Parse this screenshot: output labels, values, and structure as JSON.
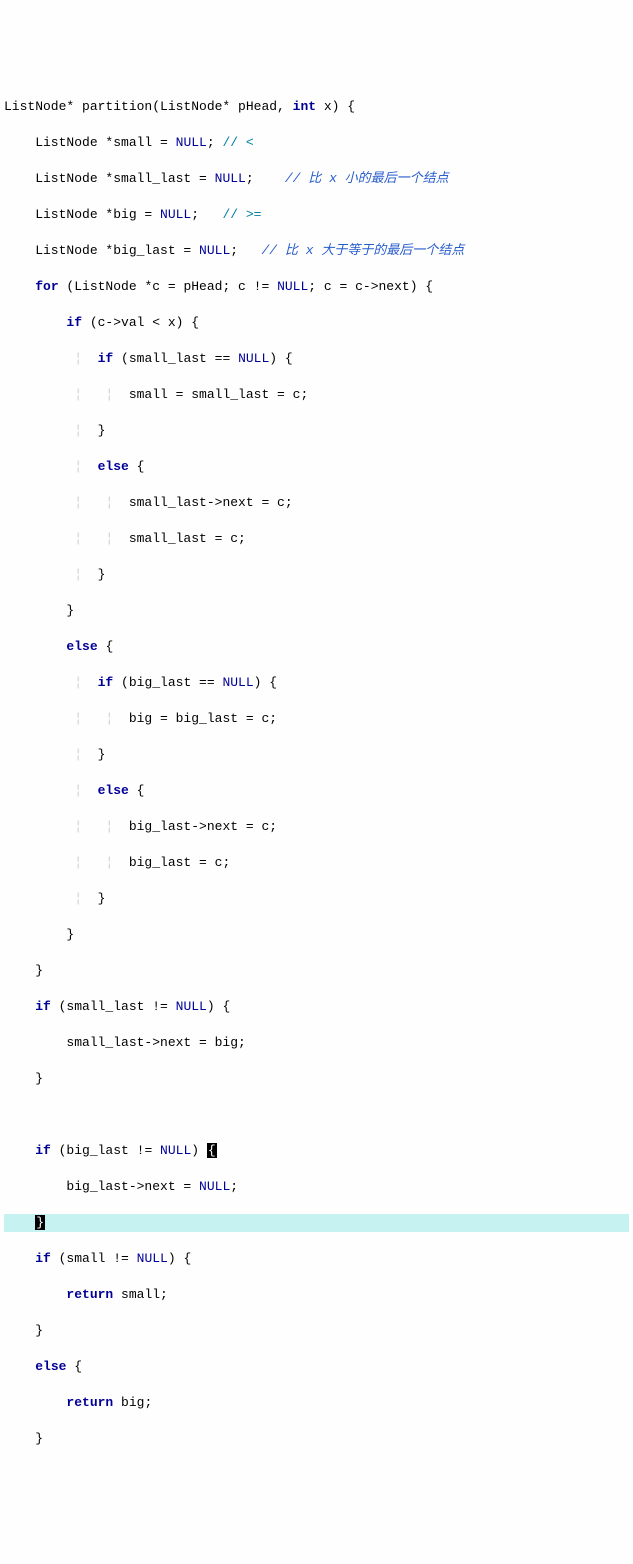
{
  "code": {
    "l01_sig_a": "ListNode* partition(ListNode* pHead, ",
    "l01_kw": "int",
    "l01_sig_b": " x) {",
    "l02_a": "    ListNode *small = ",
    "l02_null": "NULL",
    "l02_b": "; ",
    "l02_c": "// <",
    "l03_a": "    ListNode *small_last = ",
    "l03_null": "NULL",
    "l03_b": ";    ",
    "l03_c": "// 比 x 小的最后一个结点",
    "l04_a": "    ListNode *big = ",
    "l04_null": "NULL",
    "l04_b": ";   ",
    "l04_c": "// >=",
    "l05_a": "    ListNode *big_last = ",
    "l05_null": "NULL",
    "l05_b": ";   ",
    "l05_c": "// 比 x 大于等于的最后一个结点",
    "l06_a": "    ",
    "l06_for": "for",
    "l06_b": " (ListNode *c = pHead; c != ",
    "l06_null": "NULL",
    "l06_c": "; c = c->next) {",
    "l07_a": "        ",
    "l07_if": "if",
    "l07_b": " (c->val < x) {",
    "l08_a": "            ",
    "l08_if": "if",
    "l08_b": " (small_last == ",
    "l08_null": "NULL",
    "l08_c": ") {",
    "l09": "                small = small_last = c;",
    "l10": "            }",
    "l11_a": "            ",
    "l11_else": "else",
    "l11_b": " {",
    "l12": "                small_last->next = c;",
    "l13": "                small_last = c;",
    "l14": "            }",
    "l15": "        }",
    "l16_a": "        ",
    "l16_else": "else",
    "l16_b": " {",
    "l17_a": "            ",
    "l17_if": "if",
    "l17_b": " (big_last == ",
    "l17_null": "NULL",
    "l17_c": ") {",
    "l18": "                big = big_last = c;",
    "l19": "            }",
    "l20_a": "            ",
    "l20_else": "else",
    "l20_b": " {",
    "l21": "                big_last->next = c;",
    "l22": "                big_last = c;",
    "l23": "            }",
    "l24": "        }",
    "l25": "    }",
    "l26_a": "    ",
    "l26_if": "if",
    "l26_b": " (small_last != ",
    "l26_null": "NULL",
    "l26_c": ") {",
    "l27": "        small_last->next = big;",
    "l28": "    }",
    "l29": "",
    "l30_a": "    ",
    "l30_if": "if",
    "l30_b": " (big_last != ",
    "l30_null": "NULL",
    "l30_c": ") ",
    "l30_cur": "{",
    "l31": "        big_last->next = ",
    "l31_null": "NULL",
    "l31_b": ";",
    "l32_a": "    ",
    "l32_cur": "}",
    "l33_a": "    ",
    "l33_if": "if",
    "l33_b": " (small != ",
    "l33_null": "NULL",
    "l33_c": ") {",
    "l34_a": "        ",
    "l34_ret": "return",
    "l34_b": " small;",
    "l35": "    }",
    "l36_a": "    ",
    "l36_else": "else",
    "l36_b": " {",
    "l37_a": "        ",
    "l37_ret": "return",
    "l37_b": " big;",
    "l38": "    }"
  }
}
